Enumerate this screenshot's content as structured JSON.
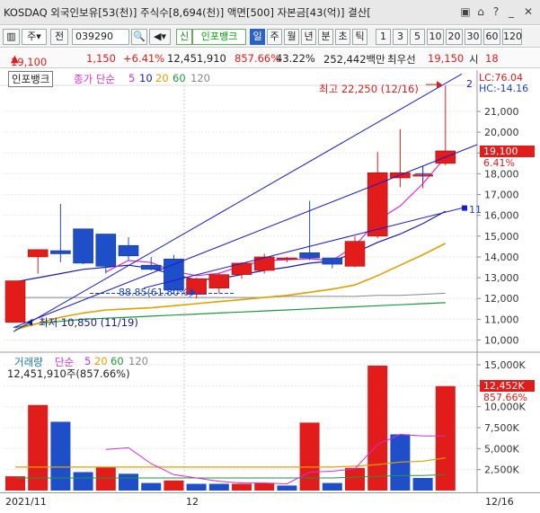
{
  "window": {
    "title": "KOSDAQ 외국인보유[53(천)] 주식수[8,694(천)] 액면[500] 자본금[43(억)] 결산["
  },
  "toolbar": {
    "period_select": "주",
    "prev_label": "전",
    "code": "039290",
    "stock_name": "인포뱅크",
    "sin_label": "신",
    "period_buttons": [
      "일",
      "주",
      "월",
      "년",
      "분",
      "초",
      "틱"
    ],
    "selected_period": "일",
    "interval_buttons": [
      "1",
      "3",
      "5",
      "10",
      "20",
      "30",
      "60",
      "120"
    ]
  },
  "pricebar": {
    "price": "19,100",
    "change": "1,150",
    "change_pct": "+6.41%",
    "volume": "12,451,910",
    "vol_ratio": "857.66%",
    "turnover": "43.22%",
    "amount": "252,442백만",
    "best_bid_label": "최우선",
    "best_bid": "19,150",
    "si_label": "시",
    "si_value": "18"
  },
  "price_panel": {
    "stock_tab": "인포뱅크",
    "ma_title": "종가 단순",
    "ma_periods": [
      "5",
      "10",
      "20",
      "60",
      "120"
    ],
    "lc_label": "LC:76.04",
    "hc_label": "HC:-14.16",
    "high_annot": "최고 22,250 (12/16)",
    "low_annot": "최저 10,850 (11/19)",
    "last_price_label": "19,100",
    "last_pct_label": "6.41%",
    "line_label": "11",
    "top_line_label": "2",
    "fib_label": "88.85(61.80%)",
    "colors": {
      "up": "#e21b1b",
      "down": "#1f4fc8",
      "ma5": "#d62bd6",
      "ma10": "#1b1bb0",
      "ma20": "#e0a000",
      "ma60": "#1a9a3a",
      "ma120": "#888888",
      "trend": "#1b1bd0"
    }
  },
  "volume_panel": {
    "title": "거래량",
    "ma_title": "단순",
    "ma_periods": [
      "5",
      "20",
      "60",
      "120"
    ],
    "current": "12,451,910주(857.66%)",
    "last_label": "12,452K",
    "last_pct_label": "857.66%"
  },
  "x_axis": {
    "start": "2021/11",
    "month_mark": "12",
    "end": "12/16"
  },
  "chart_data": [
    {
      "type": "candlestick",
      "title": "인포뱅크",
      "ylim": [
        9500,
        23000
      ],
      "y_ticks": [
        10000,
        11000,
        12000,
        13000,
        14000,
        15000,
        16000,
        17000,
        18000,
        19000,
        20000,
        21000
      ],
      "y_tick_labels": [
        "10,000",
        "11,000",
        "12,000",
        "13,000",
        "14,000",
        "15,000",
        "16,000",
        "17,000",
        "18,000",
        "19,000",
        "20,000",
        "21,000"
      ],
      "candles": [
        {
          "o": 10850,
          "h": 12850,
          "l": 10850,
          "c": 12850
        },
        {
          "o": 14000,
          "h": 14350,
          "l": 13200,
          "c": 14350
        },
        {
          "o": 14300,
          "h": 16550,
          "l": 13750,
          "c": 14150
        },
        {
          "o": 15350,
          "h": 15350,
          "l": 13650,
          "c": 13700
        },
        {
          "o": 15100,
          "h": 15100,
          "l": 13200,
          "c": 13550
        },
        {
          "o": 14550,
          "h": 14950,
          "l": 13850,
          "c": 14050
        },
        {
          "o": 13600,
          "h": 14000,
          "l": 13350,
          "c": 13400
        },
        {
          "o": 13900,
          "h": 14100,
          "l": 12200,
          "c": 12400
        },
        {
          "o": 12200,
          "h": 13000,
          "l": 12000,
          "c": 12950
        },
        {
          "o": 12500,
          "h": 13250,
          "l": 12250,
          "c": 13150
        },
        {
          "o": 13150,
          "h": 13750,
          "l": 12950,
          "c": 13700
        },
        {
          "o": 13350,
          "h": 14150,
          "l": 13200,
          "c": 14000
        },
        {
          "o": 13950,
          "h": 14000,
          "l": 13750,
          "c": 13950
        },
        {
          "o": 14200,
          "h": 16700,
          "l": 13850,
          "c": 13950
        },
        {
          "o": 13950,
          "h": 13950,
          "l": 13450,
          "c": 13650
        },
        {
          "o": 13550,
          "h": 15000,
          "l": 13500,
          "c": 14750
        },
        {
          "o": 15000,
          "h": 19050,
          "l": 14900,
          "c": 18050
        },
        {
          "o": 17800,
          "h": 20150,
          "l": 17350,
          "c": 18050
        },
        {
          "o": 17950,
          "h": 18350,
          "l": 17300,
          "c": 17950
        },
        {
          "o": 18500,
          "h": 22250,
          "l": 18400,
          "c": 19100
        }
      ],
      "ma5": [
        null,
        null,
        null,
        null,
        13270,
        13830,
        13730,
        13300,
        13100,
        13210,
        13560,
        13820,
        13860,
        13910,
        13830,
        14530,
        15760,
        16450,
        17520,
        18800
      ],
      "ma10": [
        12800,
        13000,
        13200,
        13400,
        13500,
        13600,
        13450,
        13150,
        12900,
        12950,
        13150,
        13350,
        13500,
        13700,
        13800,
        14200,
        14700,
        15100,
        15600,
        16200
      ],
      "ma20": [
        10500,
        10800,
        11100,
        11300,
        11450,
        11500,
        11550,
        11650,
        11750,
        11850,
        11950,
        12050,
        12150,
        12300,
        12450,
        12650,
        13100,
        13600,
        14100,
        14650
      ],
      "ma60": [
        10600,
        10800,
        10900,
        11000,
        11050,
        11100,
        11150,
        11200,
        11250,
        11300,
        11350,
        11400,
        11450,
        11500,
        11550,
        11600,
        11650,
        11700,
        11750,
        11800
      ],
      "ma120": [
        12050,
        12050,
        12050,
        12050,
        12050,
        12050,
        12050,
        12050,
        12050,
        12050,
        12050,
        12050,
        12100,
        12100,
        12100,
        12100,
        12150,
        12150,
        12200,
        12250
      ]
    },
    {
      "type": "bar",
      "title": "거래량",
      "ylim": [
        0,
        15500
      ],
      "y_ticks": [
        2500,
        5000,
        7500,
        10000,
        12500,
        15000
      ],
      "y_tick_labels": [
        "2,500K",
        "5,000K",
        "7,500K",
        "10,000K",
        "12,500K",
        "15,000K"
      ],
      "values": [
        1700,
        10200,
        8200,
        2200,
        2800,
        2000,
        900,
        1200,
        800,
        800,
        800,
        900,
        600,
        8100,
        900,
        2700,
        14900,
        6700,
        1500,
        12452
      ],
      "direction": [
        "up",
        "up",
        "down",
        "down",
        "up",
        "down",
        "down",
        "up",
        "down",
        "down",
        "up",
        "up",
        "down",
        "up",
        "down",
        "up",
        "up",
        "down",
        "down",
        "up"
      ],
      "ma5": [
        null,
        null,
        null,
        null,
        4900,
        5100,
        3200,
        1900,
        1500,
        1100,
        900,
        900,
        800,
        2200,
        2300,
        2600,
        5500,
        6700,
        6500,
        6500
      ],
      "ma20": [
        2800,
        2800,
        2800,
        2800,
        2800,
        2800,
        2800,
        2800,
        2800,
        2800,
        2800,
        2800,
        2800,
        2800,
        2800,
        2900,
        3100,
        3400,
        3500,
        3900
      ],
      "ma60": [
        1500,
        1500,
        1500,
        1500,
        1500,
        1500,
        1500,
        1500,
        1500,
        1500,
        1500,
        1500,
        1500,
        1500,
        1500,
        1600,
        1700,
        1800,
        1800,
        1900
      ]
    }
  ]
}
